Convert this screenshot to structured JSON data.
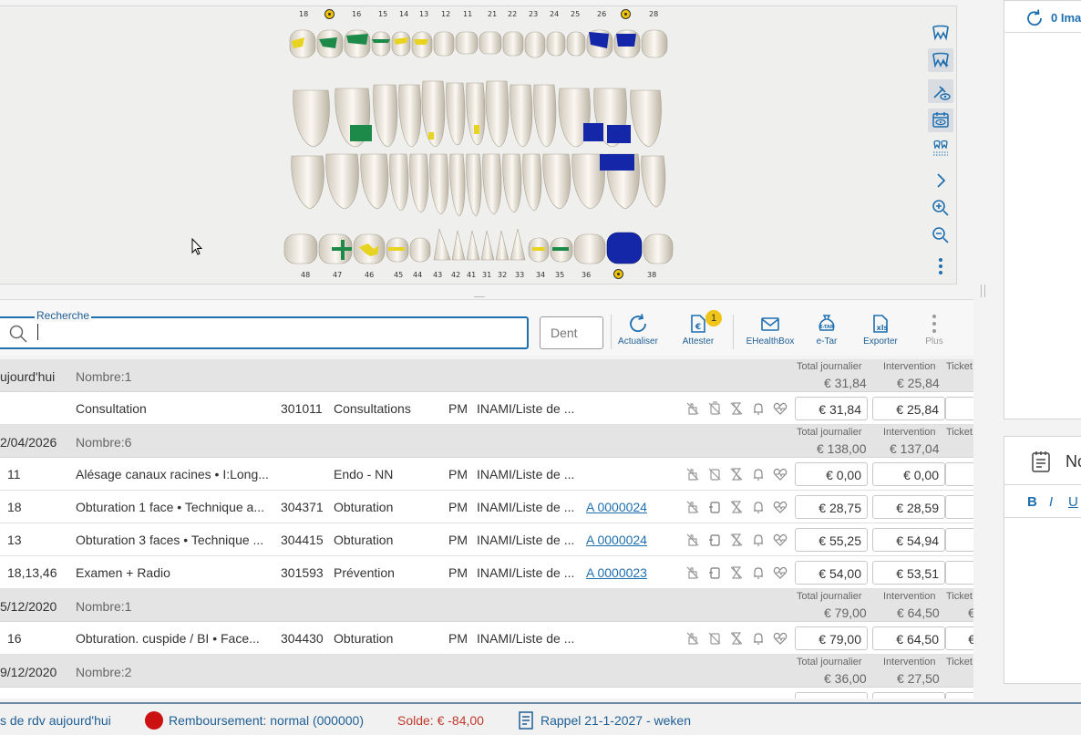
{
  "odontogram": {
    "upper_numbers": [
      "18",
      "16",
      "15",
      "14",
      "13",
      "12",
      "11",
      "21",
      "22",
      "23",
      "24",
      "25",
      "26",
      "28"
    ],
    "lower_numbers": [
      "48",
      "47",
      "46",
      "45",
      "44",
      "43",
      "42",
      "41",
      "31",
      "32",
      "33",
      "34",
      "35",
      "36",
      "38"
    ],
    "toolbar_icons": [
      "upper-jaw-icon",
      "lower-jaw-icon",
      "implant-eye-icon",
      "calendar-eye-icon",
      "teeth-grid-icon",
      "chevron-right-icon",
      "zoom-in-icon",
      "zoom-out-icon",
      "more-vertical-icon"
    ]
  },
  "right_panel": {
    "images_label": "0 Ima",
    "notes_label": "No",
    "format_bold": "B",
    "format_italic": "I",
    "format_underline": "U"
  },
  "toolbar": {
    "search_label": "Recherche",
    "search_value": "",
    "dent_placeholder": "Dent",
    "buttons": {
      "refresh": "Actualiser",
      "attest": "Attester",
      "attest_badge": "1",
      "ehealthbox": "EHealthBox",
      "etar": "e-Tar",
      "export": "Exporter",
      "more": "Plus"
    }
  },
  "table": {
    "groups": [
      {
        "date": "ujourd'hui",
        "count": "Nombre:1",
        "total_label": "Total journalier",
        "total": "€ 31,84",
        "intervention_label": "Intervention",
        "intervention": "€ 25,84",
        "ticket_label": "Ticket",
        "ticket": "",
        "rows": [
          {
            "tooth": "",
            "description": "Consultation",
            "code": "301011",
            "category": "Consultations",
            "provider": "PM",
            "list": "INAMI/Liste de ...",
            "attest": "",
            "total": "€ 31,84",
            "intervention": "€ 25,84"
          }
        ]
      },
      {
        "date": "2/04/2026",
        "count": "Nombre:6",
        "total_label": "Total journalier",
        "total": "€ 138,00",
        "intervention_label": "Intervention",
        "intervention": "€ 137,04",
        "ticket_label": "Ticket",
        "ticket": "",
        "rows": [
          {
            "tooth": "11",
            "description": "Alésage canaux racines  •  I:Long...",
            "code": "",
            "category": "Endo - NN",
            "provider": "PM",
            "list": "INAMI/Liste de ...",
            "attest": "",
            "total": "€ 0,00",
            "intervention": "€ 0,00"
          },
          {
            "tooth": "18",
            "description": "Obturation 1 face  •  Technique a...",
            "code": "304371",
            "category": "Obturation",
            "provider": "PM",
            "list": "INAMI/Liste de ...",
            "attest": "A 0000024",
            "total": "€ 28,75",
            "intervention": "€ 28,59"
          },
          {
            "tooth": "13",
            "description": "Obturation 3 faces  •  Technique ...",
            "code": "304415",
            "category": "Obturation",
            "provider": "PM",
            "list": "INAMI/Liste de ...",
            "attest": "A 0000024",
            "total": "€ 55,25",
            "intervention": "€ 54,94"
          },
          {
            "tooth": "18,13,46",
            "description": "Examen + Radio",
            "code": "301593",
            "category": "Prévention",
            "provider": "PM",
            "list": "INAMI/Liste de ...",
            "attest": "A 0000023",
            "total": "€ 54,00",
            "intervention": "€ 53,51"
          }
        ]
      },
      {
        "date": "5/12/2020",
        "count": "Nombre:1",
        "total_label": "Total journalier",
        "total": "€ 79,00",
        "intervention_label": "Intervention",
        "intervention": "€ 64,50",
        "ticket_label": "Ticket",
        "ticket": "€",
        "rows": [
          {
            "tooth": "16",
            "description": "Obturation. cuspide / BI  •  Face...",
            "code": "304430",
            "category": "Obturation",
            "provider": "PM",
            "list": "INAMI/Liste de ...",
            "attest": "",
            "total": "€ 79,00",
            "intervention": "€ 64,50",
            "ticket": "€"
          }
        ]
      },
      {
        "date": "9/12/2020",
        "count": "Nombre:2",
        "total_label": "Total journalier",
        "total": "€ 36,00",
        "intervention_label": "Intervention",
        "intervention": "€ 27,50",
        "ticket_label": "Ticket",
        "ticket": "",
        "rows": []
      }
    ],
    "row_icons": [
      "no-touch-icon",
      "phone-mobile-icon",
      "hourglass-icon",
      "bell-icon",
      "heart-pulse-icon"
    ]
  },
  "statusbar": {
    "appointments": "s de rdv aujourd'hui",
    "reimbursement": "Remboursement: normal (000000)",
    "balance": "Solde: € -84,00",
    "reminder": "Rappel 21-1-2027 - weken"
  },
  "colors": {
    "accent": "#1e6fb0",
    "status_red": "#cc1111",
    "balance_red": "#c0392b",
    "filling_green": "#1d8a4a",
    "filling_blue": "#1327a8",
    "filling_yellow": "#e8d320"
  }
}
